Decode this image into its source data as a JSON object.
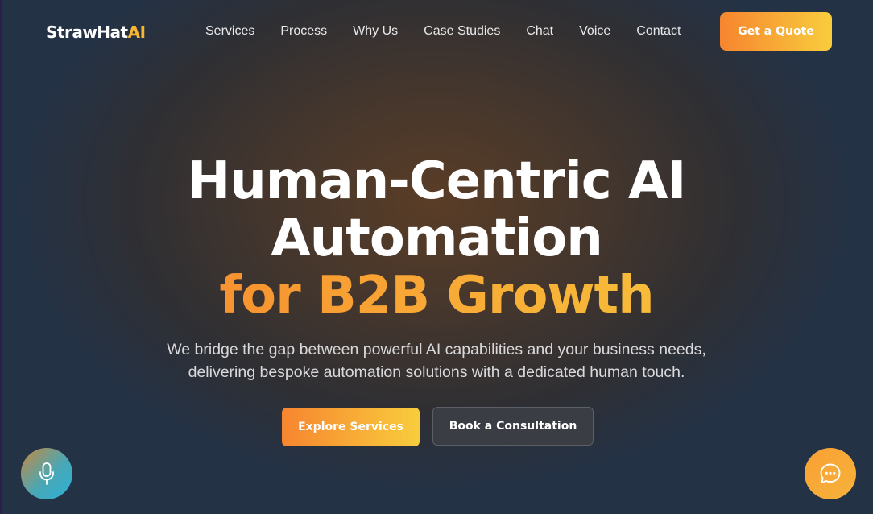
{
  "nav": {
    "logo_main": "StrawHat",
    "logo_accent": "AI",
    "links": [
      "Services",
      "Process",
      "Why Us",
      "Case Studies",
      "Chat",
      "Voice",
      "Contact"
    ],
    "cta_label": "Get a Quote"
  },
  "hero": {
    "title_line1": "Human-Centric AI",
    "title_line2": "Automation",
    "title_accent": "for B2B Growth",
    "subtitle_line1": "We bridge the gap between powerful AI capabilities and your business needs,",
    "subtitle_line2": "delivering bespoke automation solutions with a dedicated human touch.",
    "primary_button": "Explore Services",
    "secondary_button": "Book a Consultation"
  },
  "floating": {
    "mic_icon": "microphone-icon",
    "chat_icon": "chat-bubble-icon"
  },
  "colors": {
    "accent_start": "#f7852f",
    "accent_end": "#f8cd3d",
    "logo_accent": "#f7b733"
  }
}
